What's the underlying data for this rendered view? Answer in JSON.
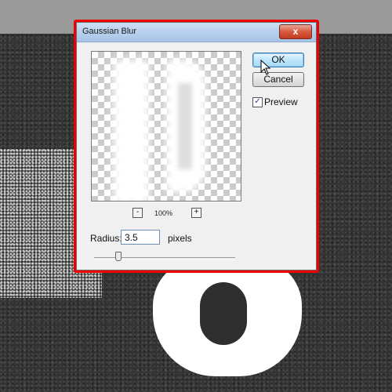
{
  "dialog": {
    "title": "Gaussian Blur",
    "close_symbol": "x",
    "ok_label": "OK",
    "cancel_label": "Cancel",
    "preview_label": "Preview",
    "preview_checked": true,
    "zoom_out_symbol": "-",
    "zoom_in_symbol": "+",
    "zoom_level": "100%",
    "radius_label": "Radius:",
    "radius_value": "3.5",
    "radius_units": "pixels"
  },
  "icons": {
    "close": "close-icon",
    "zoom_out": "minus-icon",
    "zoom_in": "plus-icon",
    "check": "checkmark-icon",
    "cursor": "mouse-pointer-icon"
  },
  "colors": {
    "highlight_frame": "#ee0000",
    "titlebar": "#b9d1ee",
    "close_button": "#d65a3f",
    "ok_button": "#bee6fd"
  }
}
